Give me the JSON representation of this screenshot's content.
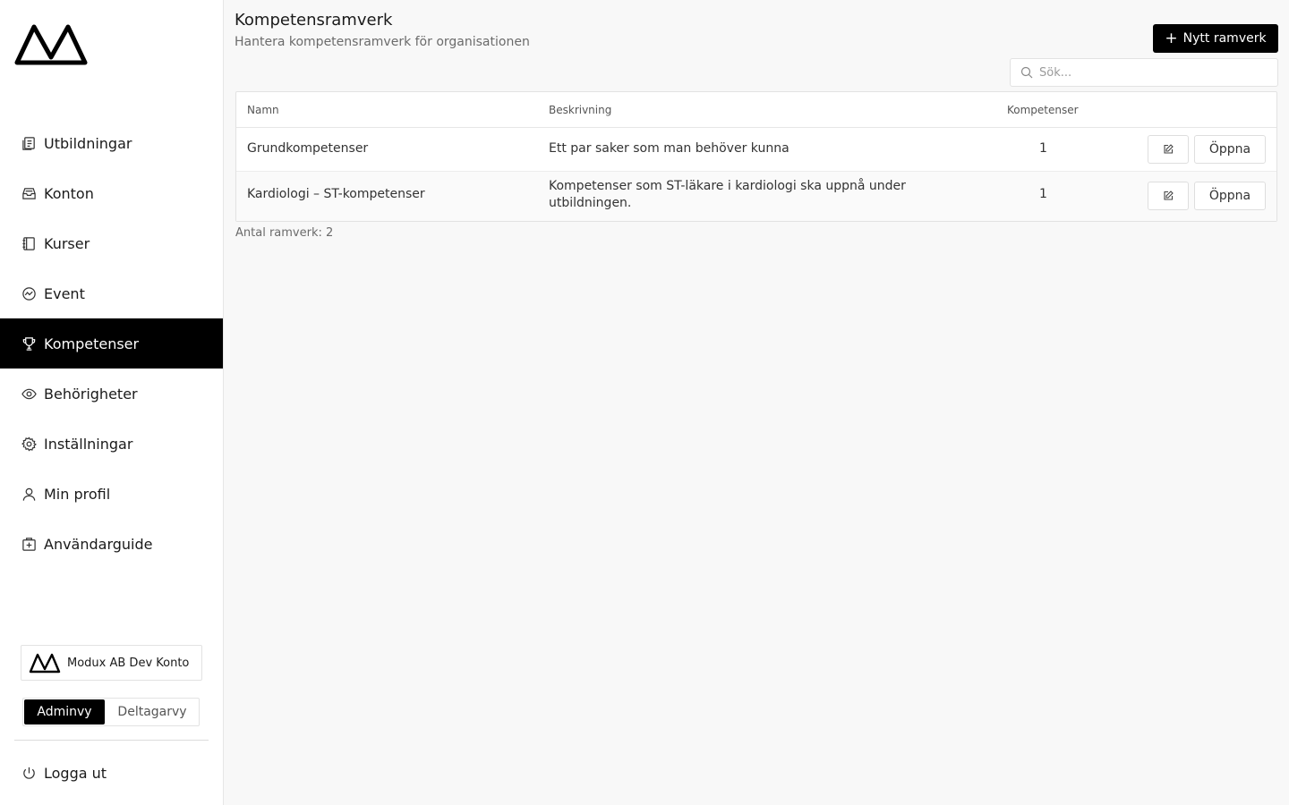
{
  "sidebar": {
    "items": [
      {
        "label": "Utbildningar",
        "icon": "courses-icon"
      },
      {
        "label": "Konton",
        "icon": "inbox-icon"
      },
      {
        "label": "Kurser",
        "icon": "notebook-icon"
      },
      {
        "label": "Event",
        "icon": "chart-circle-icon"
      },
      {
        "label": "Kompetenser",
        "icon": "trophy-icon",
        "active": true
      },
      {
        "label": "Behörigheter",
        "icon": "eye-icon"
      },
      {
        "label": "Inställningar",
        "icon": "gear-icon"
      },
      {
        "label": "Min profil",
        "icon": "user-icon"
      },
      {
        "label": "Användarguide",
        "icon": "guide-icon"
      }
    ],
    "account_name": "Modux AB Dev Konto",
    "view_toggle": {
      "admin": "Adminvy",
      "participant": "Deltagarvy",
      "selected": "Adminvy"
    },
    "logout_label": "Logga ut"
  },
  "header": {
    "title": "Kompetensramverk",
    "subtitle": "Hantera kompetensramverk för organisationen",
    "new_button": "Nytt ramverk"
  },
  "search": {
    "placeholder": "Sök..."
  },
  "table": {
    "columns": {
      "name": "Namn",
      "description": "Beskrivning",
      "competencies": "Kompetenser"
    },
    "rows": [
      {
        "name": "Grundkompetenser",
        "description": "Ett par saker som man behöver kunna",
        "competencies": "1",
        "open": "Öppna"
      },
      {
        "name": "Kardiologi – ST-kompetenser",
        "description": "Kompetenser som ST-läkare i kardiologi ska uppnå under utbildningen.",
        "competencies": "1",
        "open": "Öppna"
      }
    ]
  },
  "footer_count": "Antal ramverk: 2",
  "colors": {
    "accent": "#000000",
    "background": "#f8f8f8",
    "border": "#e2e2e2",
    "muted_text": "#6b6b6b"
  }
}
